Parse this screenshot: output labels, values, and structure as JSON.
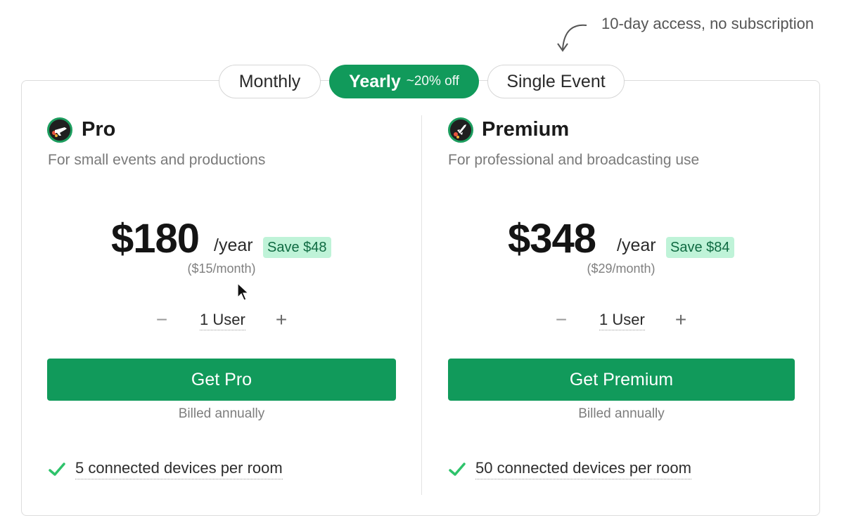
{
  "callout": {
    "text": "10-day access, no subscription"
  },
  "billing_toggle": {
    "monthly": "Monthly",
    "yearly": "Yearly",
    "yearly_badge": "~20% off",
    "single_event": "Single Event",
    "selected": "Yearly"
  },
  "plans": [
    {
      "name": "Pro",
      "icon": "airplane-icon",
      "description": "For small events and productions",
      "price": "$180",
      "period": "/year",
      "savings": "Save $48",
      "monthly_equivalent": "($15/month)",
      "users": "1 User",
      "decrement": "−",
      "increment": "+",
      "cta": "Get Pro",
      "billing_note": "Billed annually",
      "features": [
        "5 connected devices per room"
      ]
    },
    {
      "name": "Premium",
      "icon": "rocket-icon",
      "description": "For professional and broadcasting use",
      "price": "$348",
      "period": "/year",
      "savings": "Save $84",
      "monthly_equivalent": "($29/month)",
      "users": "1 User",
      "decrement": "−",
      "increment": "+",
      "cta": "Get Premium",
      "billing_note": "Billed annually",
      "features": [
        "50 connected devices per room"
      ]
    }
  ],
  "colors": {
    "accent": "#119a5b",
    "save_badge_bg": "#bff3d8",
    "save_badge_text": "#0f6b42",
    "check": "#2ec36b"
  }
}
